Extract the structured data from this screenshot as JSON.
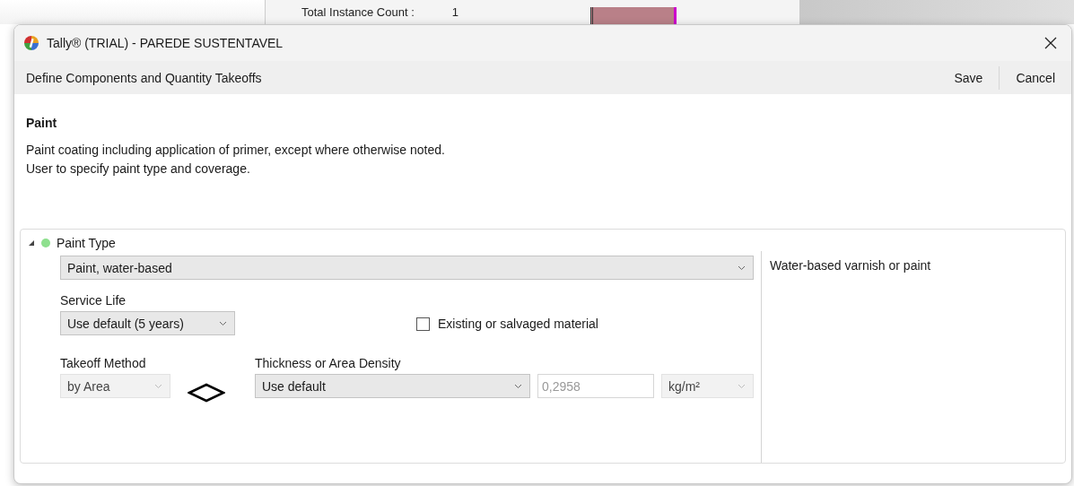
{
  "background_window": {
    "label": "Total Instance Count :",
    "value": "1"
  },
  "window": {
    "title": "Tally® (TRIAL) - PAREDE SUSTENTAVEL"
  },
  "toolbar": {
    "title": "Define Components and Quantity Takeoffs",
    "buttons": [
      "Save",
      "Cancel"
    ]
  },
  "component": {
    "name": "Paint",
    "description": [
      "Paint coating including application of primer, except where otherwise noted.",
      "User to specify paint type and coverage."
    ]
  },
  "material": {
    "name": "Paint Type",
    "expanded": true,
    "note": "Water-based varnish or paint",
    "selection": {
      "value": "Paint, water-based",
      "disabled": false
    },
    "service_life": {
      "label": "Service Life",
      "value": "Use default (5 years)",
      "disabled": false
    },
    "existing": {
      "label": "Existing or salvaged material",
      "checked": false
    },
    "takeoff": {
      "label": "Takeoff Method",
      "value": "by Area",
      "disabled": true
    },
    "density": {
      "label": "Thickness or Area Density",
      "value": "Use default",
      "disabled": false
    },
    "amount": {
      "value": "0,2958",
      "disabled": true
    },
    "unit": {
      "value": "kg/m²",
      "disabled": true
    }
  }
}
